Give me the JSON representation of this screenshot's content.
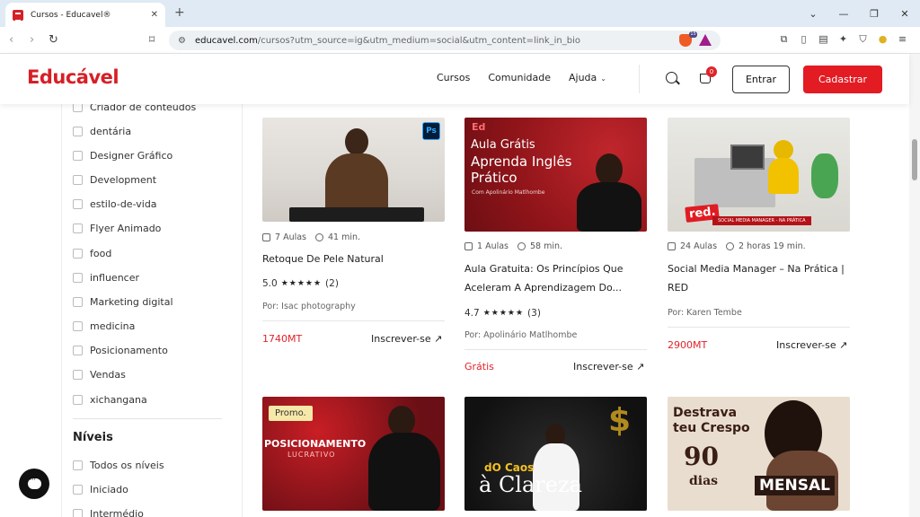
{
  "browser": {
    "tab_title": "Cursos - Educavel®",
    "url_domain": "educavel.com",
    "url_path": "/cursos?utm_source=ig&utm_medium=social&utm_content=link_in_bio"
  },
  "header": {
    "logo": "Educável",
    "nav": [
      "Cursos",
      "Comunidade",
      "Ajuda"
    ],
    "cart_count": "0",
    "login_label": "Entrar",
    "signup_label": "Cadastrar"
  },
  "sidebar": {
    "categories": [
      "Criador de conteúdos",
      "dentária",
      "Designer Gráfico",
      "Development",
      "estilo-de-vida",
      "Flyer Animado",
      "food",
      "influencer",
      "Marketing digital",
      "medicina",
      "Posicionamento",
      "Vendas",
      "xichangana"
    ],
    "levels_title": "Níveis",
    "levels": [
      "Todos os níveis",
      "Iniciado",
      "Intermédio"
    ]
  },
  "courses": [
    {
      "lessons": "7 Aulas",
      "duration": "41 min.",
      "title_lines": [
        "Retoque De Pele Natural"
      ],
      "rating": "5.0",
      "stars": "★★★★★",
      "reviews": "(2)",
      "author": "Por: Isac photography",
      "price": "1740MT",
      "enroll": "Inscrever-se",
      "thumb": {
        "badge": "Ps"
      }
    },
    {
      "lessons": "1 Aulas",
      "duration": "58 min.",
      "title_lines": [
        "Aula Gratuita: Os Princípios Que",
        "Aceleram A Aprendizagem Do..."
      ],
      "rating": "4.7",
      "stars": "★★★★★",
      "reviews": "(3)",
      "author": "Por: Apolinário Matlhombe",
      "price": "Grátis",
      "enroll": "Inscrever-se",
      "thumb": {
        "mark": "Ed",
        "line1": "Aula Grátis",
        "line2": "Aprenda Inglês",
        "line3": "Prático",
        "small": "Com Apolinário Matlhombe"
      }
    },
    {
      "lessons": "24 Aulas",
      "duration": "2 horas  19 min.",
      "title_lines": [
        "Social Media Manager – Na Prática |",
        "RED"
      ],
      "author": "Por: Karen Tembe",
      "price": "2900MT",
      "enroll": "Inscrever-se",
      "thumb": {
        "logo": "red.",
        "strip": "SOCIAL MEDIA MANAGER - NA PRÁTICA"
      }
    }
  ],
  "promos": [
    {
      "badge": "Promo.",
      "title": "POSICIONAMENTO",
      "sub": "LUCRATIVO"
    },
    {
      "line1": "dO Caos",
      "line2": "à Clareza"
    },
    {
      "line1": "Destrava",
      "line2": "teu Crespo",
      "big": "90",
      "days": "dias",
      "tag": "MENSAL"
    }
  ],
  "colors": {
    "accent": "#e31b23",
    "price": "#e0232a"
  },
  "icons": [
    "search-icon",
    "cart-icon",
    "chevron-down-icon",
    "clock-icon",
    "lessons-icon",
    "arrow-up-right-icon",
    "chat-icon"
  ]
}
